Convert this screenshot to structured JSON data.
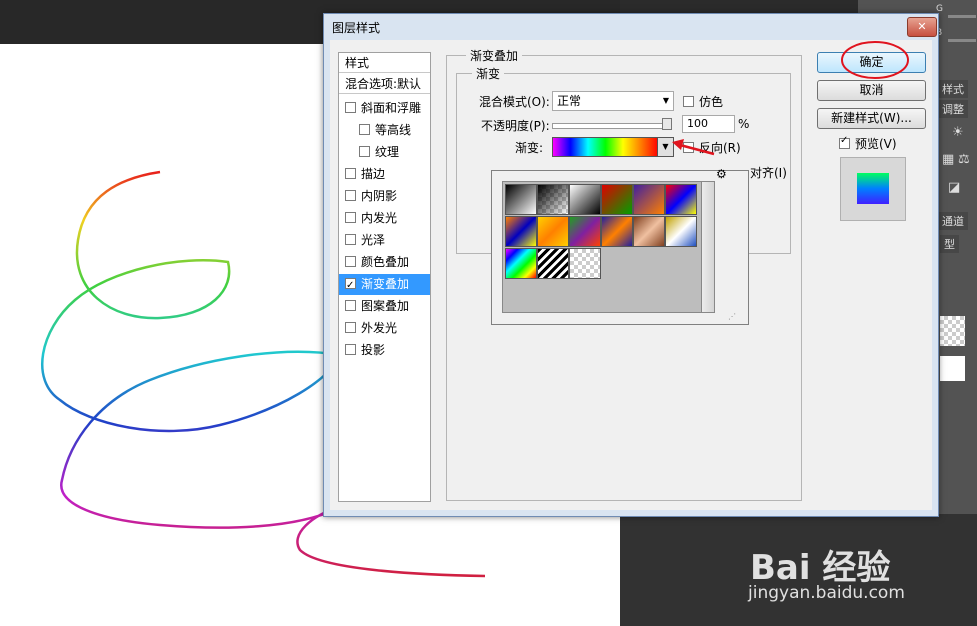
{
  "dialog": {
    "title": "图层样式",
    "close_label": "✕",
    "style_list": {
      "header": "样式",
      "blend_item": "混合选项:默认",
      "items": [
        {
          "label": "斜面和浮雕",
          "checked": false
        },
        {
          "label": "等高线",
          "checked": false
        },
        {
          "label": "纹理",
          "checked": false
        },
        {
          "label": "描边",
          "checked": false
        },
        {
          "label": "内阴影",
          "checked": false
        },
        {
          "label": "内发光",
          "checked": false
        },
        {
          "label": "光泽",
          "checked": false
        },
        {
          "label": "颜色叠加",
          "checked": false
        },
        {
          "label": "渐变叠加",
          "checked": true,
          "selected": true
        },
        {
          "label": "图案叠加",
          "checked": false
        },
        {
          "label": "外发光",
          "checked": false
        },
        {
          "label": "投影",
          "checked": false
        }
      ]
    },
    "gradient_overlay": {
      "section_title": "渐变叠加",
      "group_title": "渐变",
      "blend_mode_label": "混合模式(O):",
      "blend_mode_value": "正常",
      "dither_label": "仿色",
      "opacity_label": "不透明度(P):",
      "opacity_value": "100",
      "percent": "%",
      "gradient_label": "渐变:",
      "reverse_label": "反向(R)",
      "align_label_partial": "对齐(I)",
      "hidden_percent": "%"
    },
    "buttons": {
      "ok": "确定",
      "cancel": "取消",
      "new_style": "新建样式(W)...",
      "preview_label": "预览(V)",
      "preview_checked": true
    }
  },
  "right_panel": {
    "tab_adjust": "调整",
    "tab_styles": "样式",
    "tab_channels": "通道",
    "type_label": "型",
    "g_label": "G",
    "b_label": "B"
  },
  "watermark": {
    "logo": "Bai 经验",
    "url": "jingyan.baidu.com"
  },
  "colors": {
    "dialog_frame": "#d9e4f1",
    "selection": "#3399ff",
    "annotation_red": "#e0141e"
  }
}
